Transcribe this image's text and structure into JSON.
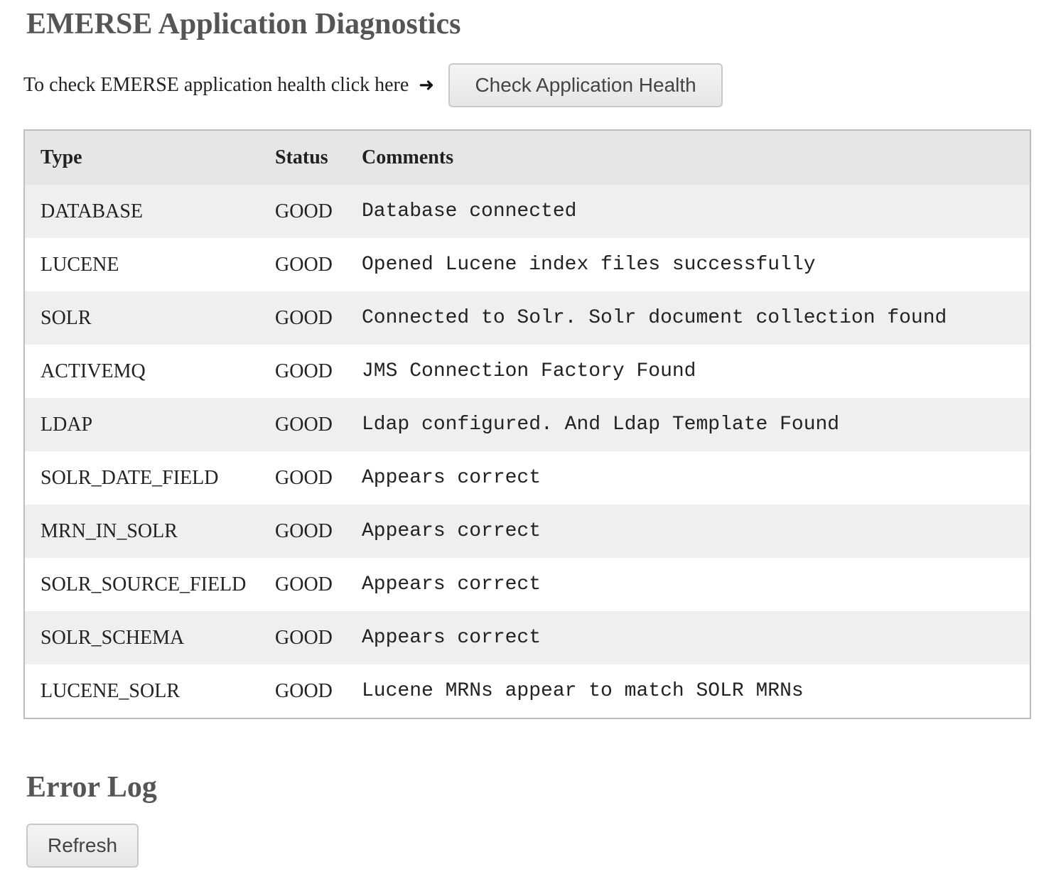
{
  "page_title": "EMERSE Application Diagnostics",
  "health_check": {
    "prompt_text": "To check EMERSE application health click here",
    "arrow": "➜",
    "button_label": "Check Application Health"
  },
  "table": {
    "headers": {
      "type": "Type",
      "status": "Status",
      "comments": "Comments"
    },
    "rows": [
      {
        "type": "DATABASE",
        "status": "GOOD",
        "comment": "Database connected"
      },
      {
        "type": "LUCENE",
        "status": "GOOD",
        "comment": "Opened Lucene index files successfully"
      },
      {
        "type": "SOLR",
        "status": "GOOD",
        "comment": "Connected to Solr. Solr document collection found"
      },
      {
        "type": "ACTIVEMQ",
        "status": "GOOD",
        "comment": "JMS Connection Factory Found"
      },
      {
        "type": "LDAP",
        "status": "GOOD",
        "comment": "Ldap configured. And Ldap Template Found"
      },
      {
        "type": "SOLR_DATE_FIELD",
        "status": "GOOD",
        "comment": "Appears correct"
      },
      {
        "type": "MRN_IN_SOLR",
        "status": "GOOD",
        "comment": "Appears correct"
      },
      {
        "type": "SOLR_SOURCE_FIELD",
        "status": "GOOD",
        "comment": "Appears correct"
      },
      {
        "type": "SOLR_SCHEMA",
        "status": "GOOD",
        "comment": "Appears correct"
      },
      {
        "type": "LUCENE_SOLR",
        "status": "GOOD",
        "comment": "Lucene MRNs appear to match SOLR MRNs"
      }
    ]
  },
  "error_log": {
    "title": "Error Log",
    "refresh_label": "Refresh"
  }
}
